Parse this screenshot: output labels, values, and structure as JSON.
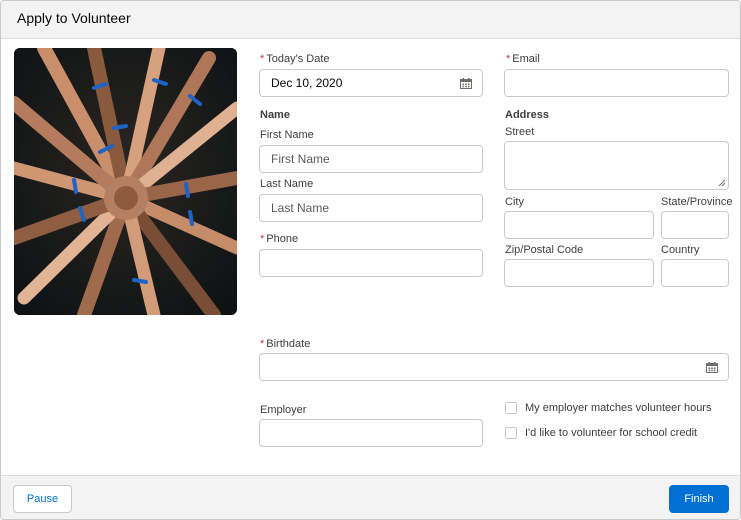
{
  "header": {
    "title": "Apply to Volunteer"
  },
  "photo": {
    "alt": "hands stacked together in a circle"
  },
  "form": {
    "todays_date": {
      "label": "Today's Date",
      "required_mark": "*",
      "value": "Dec 10, 2020"
    },
    "email": {
      "label": "Email",
      "required_mark": "*",
      "value": ""
    },
    "name_section": "Name",
    "first_name": {
      "label": "First Name",
      "placeholder": "First Name"
    },
    "last_name": {
      "label": "Last Name",
      "placeholder": "Last Name"
    },
    "phone": {
      "label": "Phone",
      "required_mark": "*",
      "value": ""
    },
    "address_section": "Address",
    "street": {
      "label": "Street",
      "value": ""
    },
    "city": {
      "label": "City",
      "value": ""
    },
    "state": {
      "label": "State/Province",
      "value": ""
    },
    "zip": {
      "label": "Zip/Postal Code",
      "value": ""
    },
    "country": {
      "label": "Country",
      "value": ""
    },
    "birthdate": {
      "label": "Birthdate",
      "required_mark": "*",
      "value": ""
    },
    "employer": {
      "label": "Employer",
      "value": ""
    },
    "employer_match": {
      "label": "My employer matches volunteer hours",
      "checked": false
    },
    "school_credit": {
      "label": "I'd like to volunteer for school credit",
      "checked": false
    }
  },
  "footer": {
    "pause_label": "Pause",
    "finish_label": "Finish"
  },
  "colors": {
    "brand": "#0070d2",
    "required": "#c23934",
    "header_bg": "#f3f3f3"
  },
  "icons": {
    "date": "calendar-icon",
    "birthdate": "calendar-icon",
    "street_resize": "resize-handle-icon"
  }
}
